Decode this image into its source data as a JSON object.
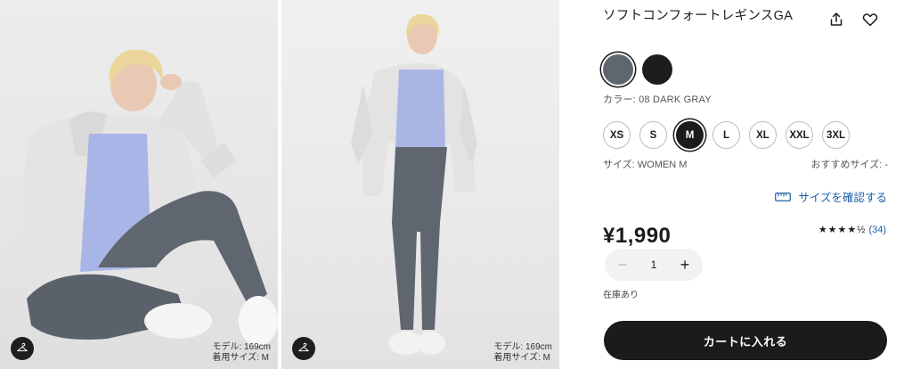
{
  "product": {
    "title": "ソフトコンフォートレギンスGA",
    "color_label": "カラー: 08 DARK GRAY",
    "colors": [
      {
        "name": "DARK GRAY",
        "hex": "#5f6670",
        "selected": true
      },
      {
        "name": "BLACK",
        "hex": "#1d1d1d",
        "selected": false
      }
    ],
    "sizes": [
      "XS",
      "S",
      "M",
      "L",
      "XL",
      "XXL",
      "3XL"
    ],
    "selected_size": "M",
    "size_label": "サイズ: WOMEN M",
    "recommended_size_label": "おすすめサイズ: -",
    "size_guide_label": "サイズを確認する",
    "price": "¥1,990",
    "rating_stars": "★★★★½",
    "review_count": "(34)",
    "quantity": "1",
    "quantity_minus": "−",
    "quantity_plus": "+",
    "stock_status": "在庫あり",
    "cart_button_label": "カートに入れる"
  },
  "photos": [
    {
      "model_height": "モデル: 169cm",
      "model_size": "着用サイズ: M"
    },
    {
      "model_height": "モデル: 169cm",
      "model_size": "着用サイズ: M"
    }
  ],
  "colors": {
    "accent_link": "#1a5fa8",
    "primary_button": "#1b1b1b",
    "legging_gray": "#5f6670"
  },
  "icons": {
    "share": "share-icon",
    "favorite": "heart-icon",
    "hanger": "hanger-icon",
    "ruler": "ruler-icon"
  }
}
